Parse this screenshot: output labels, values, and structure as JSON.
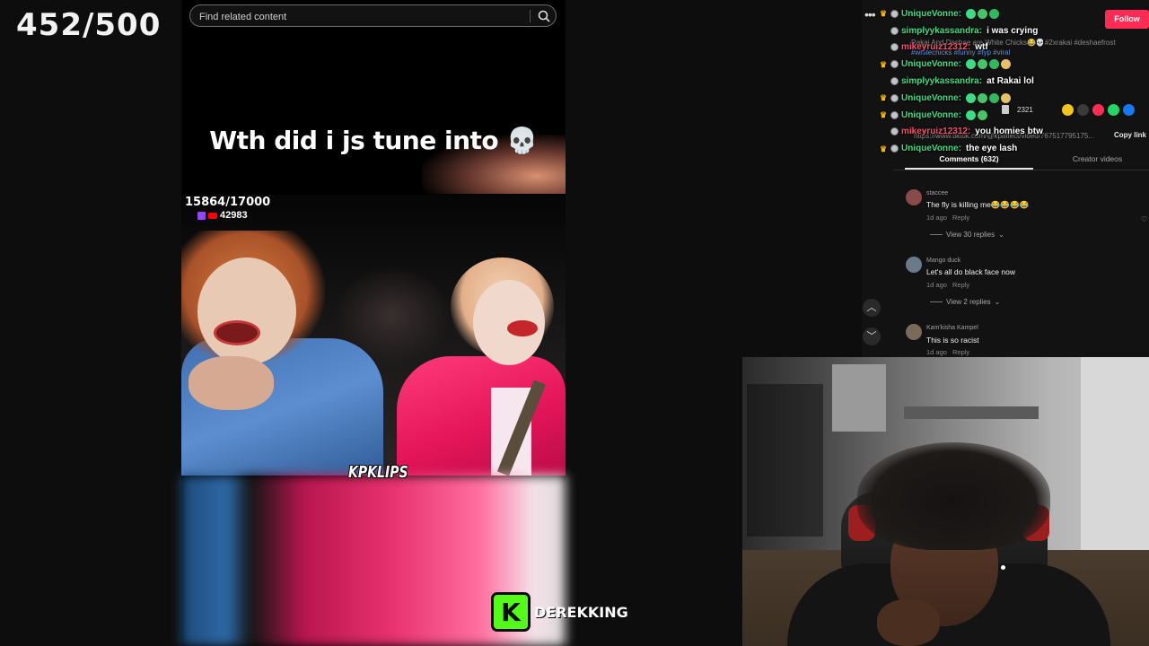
{
  "counter": "452/500",
  "search": {
    "placeholder": "Find related content"
  },
  "video": {
    "caption": "Wth did i js tune into 💀",
    "score": "15864/17000",
    "views": "42983",
    "watermark": "KPKLIPS"
  },
  "brand": {
    "logo_letter": "K",
    "name": "DEREKKING"
  },
  "tiktok": {
    "follow_label": "Follow",
    "more_label": "•••",
    "ghost_desc": "Rakai And Deshae are White Chicks😂💀#2xrakai #deshaefrost",
    "ghost_tags": "#whitechicks #funny #fyp #viral",
    "save_count": "2321",
    "url": "https://www.tiktok.com/@kpaffect/video/767517795175...",
    "copy_link": "Copy link",
    "tabs": {
      "comments": "Comments (632)",
      "creator": "Creator videos"
    },
    "comments": [
      {
        "name": "staccee",
        "text": "The fly is killing me😂😂😂😂",
        "meta": "1d ago",
        "reply": "Reply",
        "view_replies": "View 30 replies"
      },
      {
        "name": "Mango duck",
        "text": "Let's all do black face now",
        "meta": "1d ago",
        "reply": "Reply",
        "view_replies": "View 2 replies"
      },
      {
        "name": "Kam'kisha Kampel",
        "text": "This is so racist",
        "meta": "1d ago",
        "reply": "Reply"
      }
    ]
  },
  "chat": [
    {
      "user": "UniqueVonne:",
      "color": "#3ddc84",
      "crown": true,
      "msg": "",
      "emotes": 3
    },
    {
      "user": "simplyykassandra:",
      "color": "#3ddc84",
      "crown": false,
      "msg": "i was crying",
      "emotes": 0
    },
    {
      "user": "mikeyruiz12312:",
      "color": "#ff4d6d",
      "crown": false,
      "msg": "wtf",
      "emotes": 0
    },
    {
      "user": "UniqueVonne:",
      "color": "#3ddc84",
      "crown": true,
      "msg": "",
      "emotes": 4
    },
    {
      "user": "simplyykassandra:",
      "color": "#3ddc84",
      "crown": false,
      "msg": "at Rakai lol",
      "emotes": 0
    },
    {
      "user": "UniqueVonne:",
      "color": "#3ddc84",
      "crown": true,
      "msg": "",
      "emotes": 4
    },
    {
      "user": "UniqueVonne:",
      "color": "#3ddc84",
      "crown": true,
      "msg": "",
      "emotes": 2
    },
    {
      "user": "mikeyruiz12312:",
      "color": "#ff4d6d",
      "crown": false,
      "msg": "you homies btw",
      "emotes": 0
    },
    {
      "user": "UniqueVonne:",
      "color": "#3ddc84",
      "crown": true,
      "msg": "the eye lash",
      "emotes": 0
    }
  ],
  "colors": {
    "tiktok_red": "#fe2c55",
    "kick_green": "#53fc18",
    "chat_green": "#3ddc84",
    "chat_red": "#ff4d6d"
  },
  "icons": [
    "search-icon",
    "skull-emoji",
    "twitch-icon",
    "youtube-icon",
    "crown-icon",
    "chevron-up-icon",
    "chevron-down-icon",
    "bookmark-icon",
    "heart-icon"
  ]
}
